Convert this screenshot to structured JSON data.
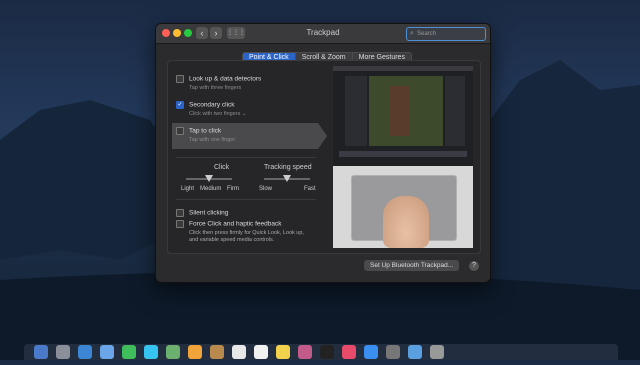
{
  "window": {
    "title": "Trackpad",
    "nav_back": "‹",
    "nav_forward": "›",
    "grid_label": "⋮⋮⋮",
    "search_placeholder": "Search"
  },
  "tabs": [
    {
      "label": "Point & Click",
      "active": true
    },
    {
      "label": "Scroll & Zoom",
      "active": false
    },
    {
      "label": "More Gestures",
      "active": false
    }
  ],
  "options": {
    "lookup": {
      "label": "Look up & data detectors",
      "sub": "Tap with three fingers",
      "checked": false
    },
    "secondary": {
      "label": "Secondary click",
      "sub": "Click with two fingers ⌄",
      "checked": true
    },
    "tap": {
      "label": "Tap to click",
      "sub": "Tap with one finger",
      "checked": false
    }
  },
  "sliders": {
    "click": {
      "title": "Click",
      "min_label": "Light",
      "mid_label": "Medium",
      "max_label": "Firm",
      "value_fraction": 0.5
    },
    "tracking": {
      "title": "Tracking speed",
      "min_label": "Slow",
      "max_label": "Fast",
      "value_fraction": 0.5
    }
  },
  "silent": {
    "label": "Silent clicking",
    "checked": false
  },
  "force": {
    "label": "Force Click and haptic feedback",
    "desc_line1": "Click then press firmly for Quick Look, Look up,",
    "desc_line2": "and variable speed media controls.",
    "checked": false
  },
  "footer": {
    "bt_button": "Set Up Bluetooth Trackpad...",
    "help": "?"
  },
  "colors": {
    "accent": "#2b63c6",
    "traffic_red": "#ff5f57",
    "traffic_yellow": "#febc2e",
    "traffic_green": "#28c840"
  },
  "icons": [
    "close-icon",
    "minimize-icon",
    "zoom-icon",
    "search-icon",
    "checkmark-icon",
    "help-icon"
  ]
}
